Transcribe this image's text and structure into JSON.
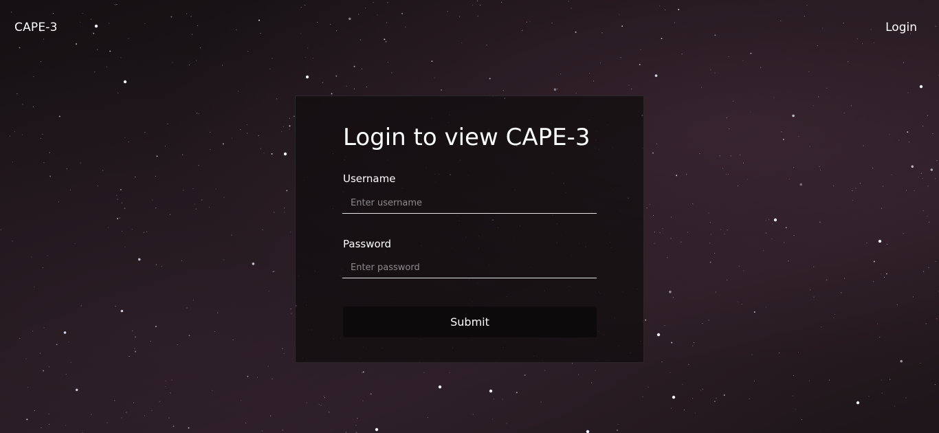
{
  "navbar": {
    "brand": "CAPE-3",
    "login_link": "Login"
  },
  "login_card": {
    "title": "Login to view CAPE-3",
    "username": {
      "label": "Username",
      "placeholder": "Enter username",
      "value": ""
    },
    "password": {
      "label": "Password",
      "placeholder": "Enter password",
      "value": ""
    },
    "submit_label": "Submit"
  },
  "colors": {
    "background": "#1b1418",
    "text": "#ffffff",
    "card_background": "#0f0c0e",
    "button_background": "#0c0a0b",
    "input_underline": "#e6e6e6"
  }
}
